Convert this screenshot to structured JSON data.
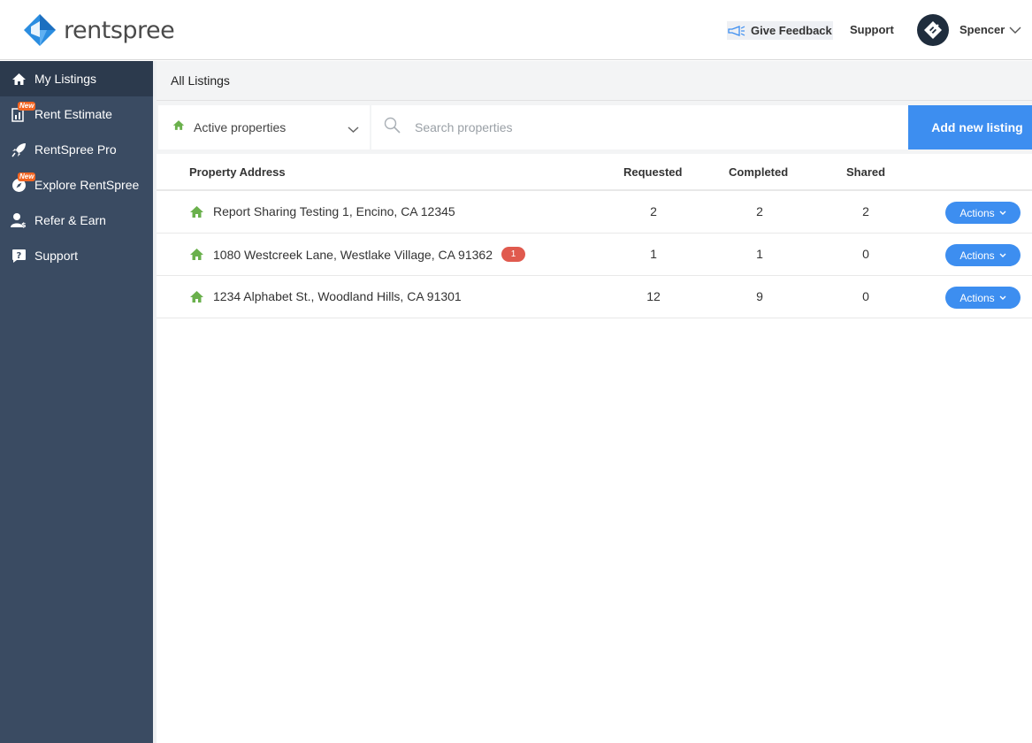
{
  "header": {
    "logo_text": "rentspree",
    "feedback_label": "Give Feedback",
    "support_label": "Support",
    "user_name": "Spencer"
  },
  "sidebar": {
    "items": [
      {
        "label": "My Listings",
        "icon": "home-icon",
        "active": true
      },
      {
        "label": "Rent Estimate",
        "icon": "chart-icon",
        "badge": "New"
      },
      {
        "label": "RentSpree Pro",
        "icon": "rocket-icon"
      },
      {
        "label": "Explore RentSpree",
        "icon": "compass-icon",
        "badge": "New"
      },
      {
        "label": "Refer & Earn",
        "icon": "user-dollar-icon"
      },
      {
        "label": "Support",
        "icon": "question-icon"
      }
    ]
  },
  "breadcrumb": "All Listings",
  "toolbar": {
    "filter_label": "Active properties",
    "search_placeholder": "Search properties",
    "add_button": "Add new listing"
  },
  "table": {
    "headers": {
      "address": "Property Address",
      "requested": "Requested",
      "completed": "Completed",
      "shared": "Shared"
    },
    "rows": [
      {
        "address": "Report Sharing Testing 1, Encino, CA 12345",
        "requested": "2",
        "completed": "2",
        "shared": "2",
        "action": "Actions"
      },
      {
        "address": "1080 Westcreek Lane, Westlake Village, CA 91362",
        "badge": "1",
        "requested": "1",
        "completed": "1",
        "shared": "0",
        "action": "Actions"
      },
      {
        "address": "1234 Alphabet St., Woodland Hills, CA 91301",
        "requested": "12",
        "completed": "9",
        "shared": "0",
        "action": "Actions"
      }
    ]
  },
  "colors": {
    "sidebar": "#3a4b62",
    "accent": "#3d8ef0",
    "home_icon": "#6ab04c",
    "badge": "#e05a4e",
    "new_badge": "#f26522"
  }
}
